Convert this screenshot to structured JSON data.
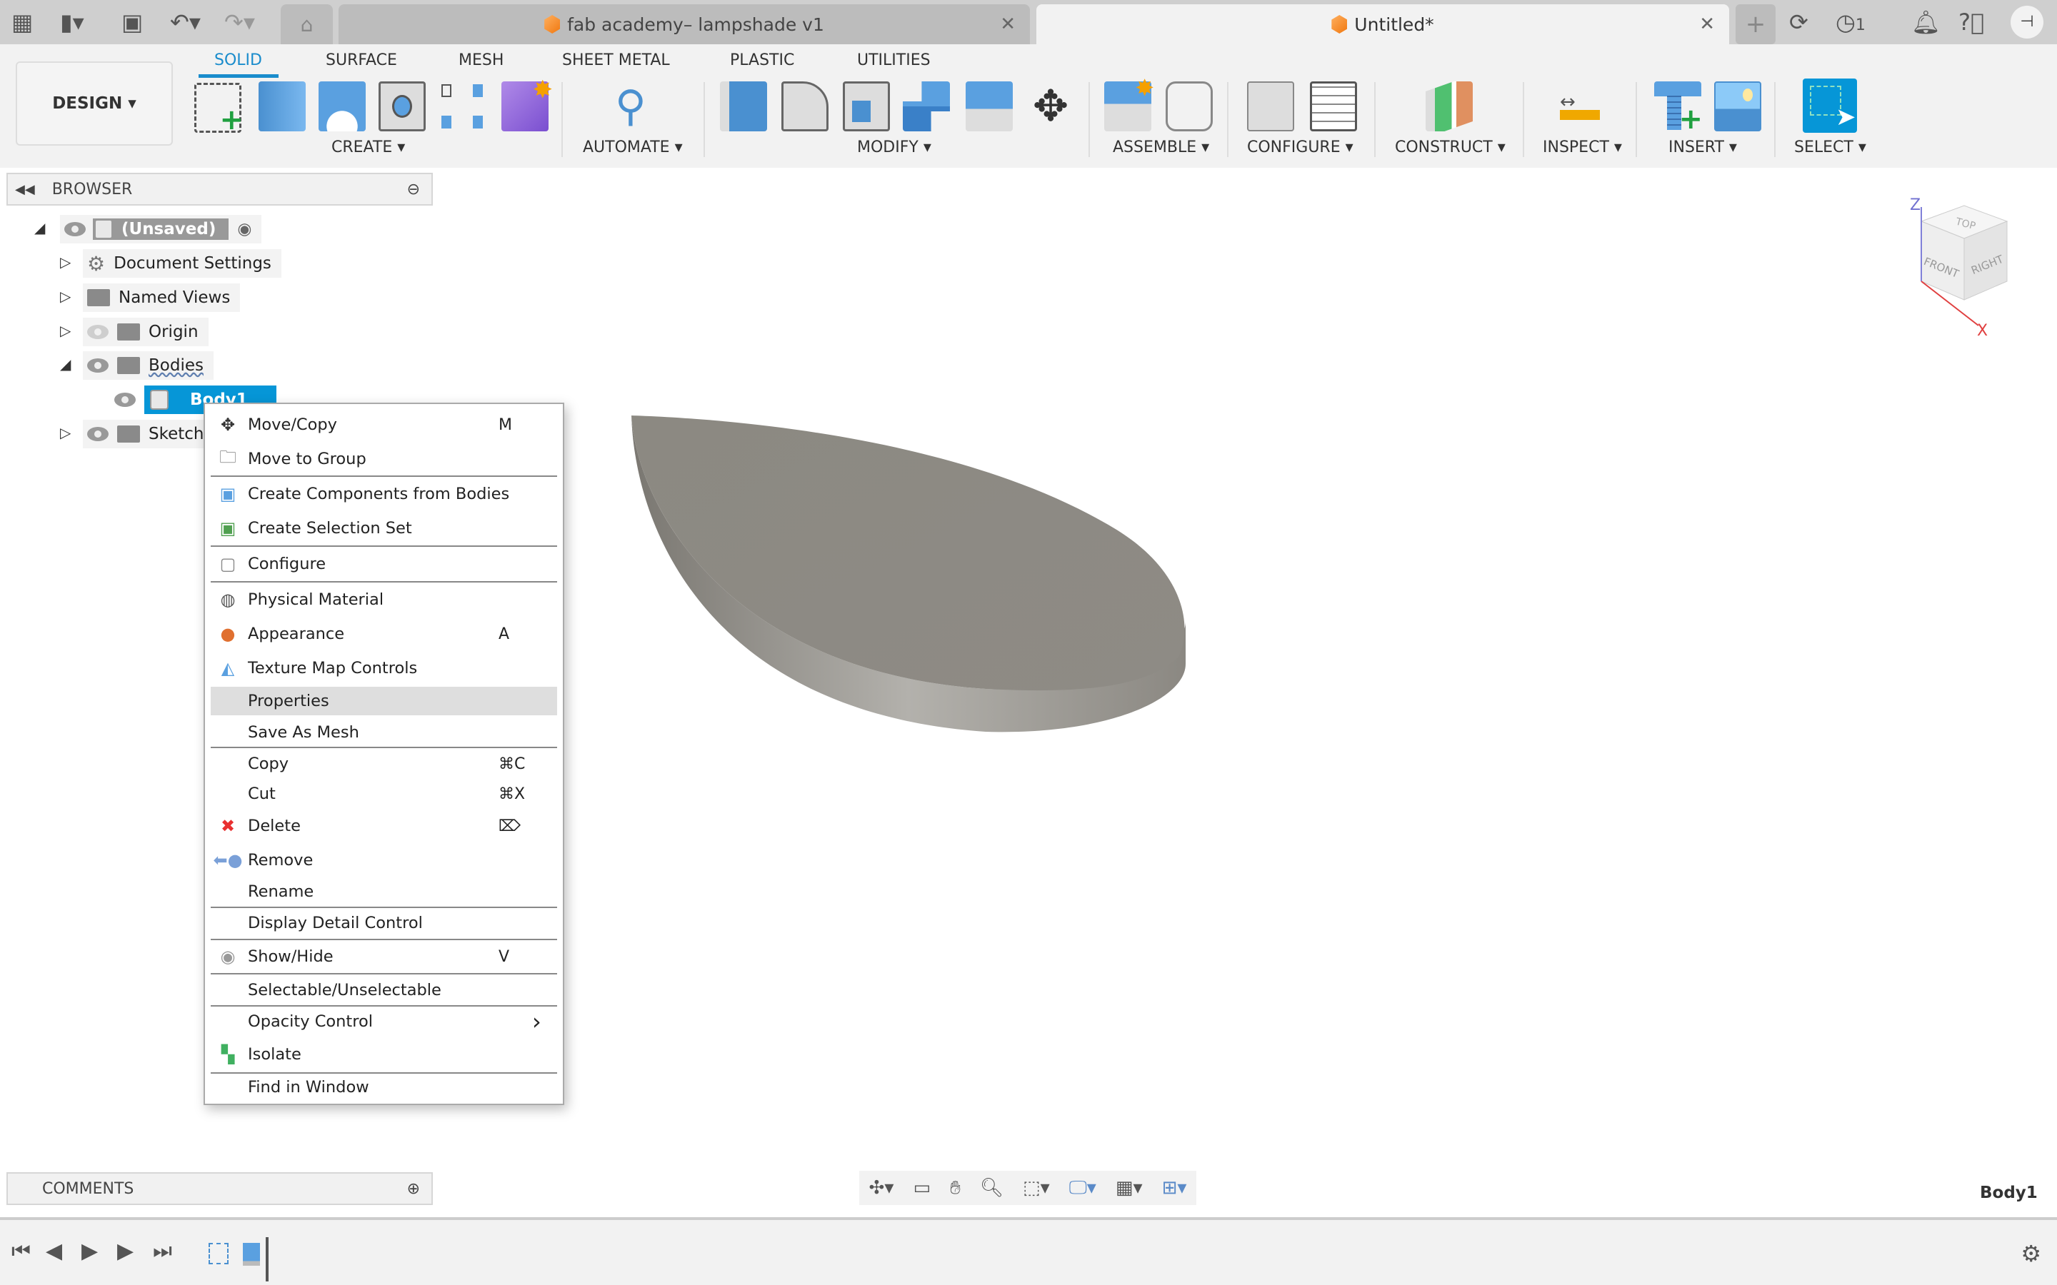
{
  "quick_access": {
    "icons": [
      "grid-icon",
      "file-icon",
      "save-icon",
      "undo-icon",
      "redo-icon",
      "home-icon"
    ]
  },
  "tabs": [
    {
      "label": "fab academy– lampshade v1",
      "active": false
    },
    {
      "label": "Untitled*",
      "active": true
    }
  ],
  "top_right": {
    "job_count": "1",
    "icons": [
      "add-tab-icon",
      "extensions-icon",
      "job-status-icon",
      "notifications-icon",
      "help-icon",
      "profile-icon"
    ]
  },
  "workspace": {
    "label": "DESIGN"
  },
  "ribbon_tabs": [
    "SOLID",
    "SURFACE",
    "MESH",
    "SHEET METAL",
    "PLASTIC",
    "UTILITIES"
  ],
  "ribbon_active_tab": "SOLID",
  "ribbon_groups": [
    "CREATE",
    "AUTOMATE",
    "MODIFY",
    "ASSEMBLE",
    "CONFIGURE",
    "CONSTRUCT",
    "INSPECT",
    "INSERT",
    "SELECT"
  ],
  "browser": {
    "title": "BROWSER",
    "items": [
      {
        "label": "(Unsaved)",
        "icon": "component-icon",
        "expanded": true
      },
      {
        "label": "Document Settings",
        "icon": "gear-icon",
        "expanded": false
      },
      {
        "label": "Named Views",
        "icon": "folder-icon",
        "expanded": false
      },
      {
        "label": "Origin",
        "icon": "folder-icon",
        "expanded": false,
        "hidden": true
      },
      {
        "label": "Bodies",
        "icon": "folder-icon",
        "expanded": true
      },
      {
        "label": "Body1",
        "icon": "body-icon",
        "selected": true
      },
      {
        "label": "Sketches",
        "icon": "folder-icon",
        "expanded": false
      }
    ]
  },
  "context_menu": [
    {
      "label": "Move/Copy",
      "shortcut": "M",
      "icon": "move-icon"
    },
    {
      "label": "Move to Group",
      "icon": "move-group-icon",
      "sep": true
    },
    {
      "label": "Create Components from Bodies",
      "icon": "create-components-icon"
    },
    {
      "label": "Create Selection Set",
      "icon": "selection-set-icon",
      "sep": true
    },
    {
      "label": "Configure",
      "icon": "configure-icon",
      "sep": true
    },
    {
      "label": "Physical Material",
      "icon": "material-icon"
    },
    {
      "label": "Appearance",
      "shortcut": "A",
      "icon": "appearance-icon"
    },
    {
      "label": "Texture Map Controls",
      "icon": "texture-icon"
    },
    {
      "label": "Properties",
      "highlighted": true
    },
    {
      "label": "Save As Mesh",
      "sep": true
    },
    {
      "label": "Copy",
      "shortcut": "⌘C"
    },
    {
      "label": "Cut",
      "shortcut": "⌘X"
    },
    {
      "label": "Delete",
      "shortcut": "⌦",
      "icon": "delete-icon"
    },
    {
      "label": "Remove",
      "icon": "remove-icon"
    },
    {
      "label": "Rename",
      "sep": true
    },
    {
      "label": "Display Detail Control",
      "sep": true
    },
    {
      "label": "Show/Hide",
      "shortcut": "V",
      "icon": "eye-icon",
      "sep": true
    },
    {
      "label": "Selectable/Unselectable",
      "sep": true
    },
    {
      "label": "Opacity Control",
      "submenu": true
    },
    {
      "label": "Isolate",
      "icon": "isolate-icon",
      "sep": true
    },
    {
      "label": "Find in Window"
    }
  ],
  "viewcube": {
    "faces": [
      "TOP",
      "FRONT",
      "RIGHT"
    ],
    "axes": [
      "Z",
      "X"
    ]
  },
  "comments": {
    "title": "COMMENTS"
  },
  "status": {
    "selection": "Body1"
  },
  "colors": {
    "accent": "#1a8ccc",
    "body": "#8f8c86",
    "selection": "#0696d7"
  }
}
